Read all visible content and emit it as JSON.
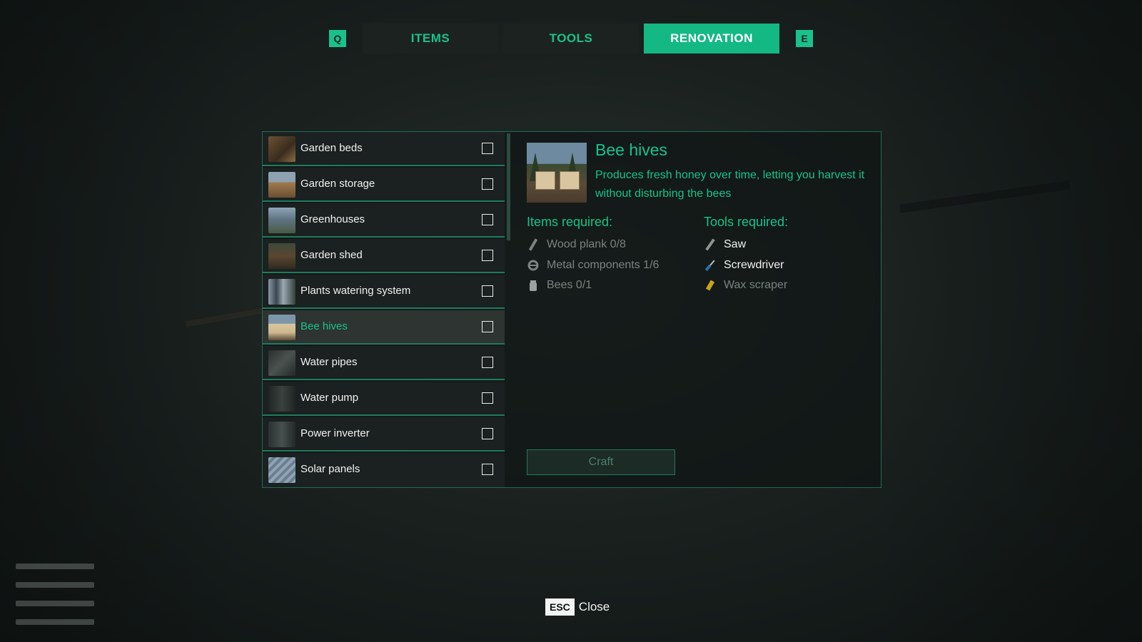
{
  "tabs": {
    "prev_key": "Q",
    "next_key": "E",
    "items": [
      {
        "label": "ITEMS",
        "active": false
      },
      {
        "label": "TOOLS",
        "active": false
      },
      {
        "label": "RENOVATION",
        "active": true
      }
    ]
  },
  "list": [
    {
      "label": "Garden beds",
      "thumb": "garden-beds",
      "selected": false,
      "checked": false
    },
    {
      "label": "Garden storage",
      "thumb": "garden-storage",
      "selected": false,
      "checked": false
    },
    {
      "label": "Greenhouses",
      "thumb": "greenhouses",
      "selected": false,
      "checked": false
    },
    {
      "label": "Garden shed",
      "thumb": "garden-shed",
      "selected": false,
      "checked": false
    },
    {
      "label": "Plants watering system",
      "thumb": "plants-watering-system",
      "selected": false,
      "checked": false
    },
    {
      "label": "Bee hives",
      "thumb": "bee-hives",
      "selected": true,
      "checked": false
    },
    {
      "label": "Water pipes",
      "thumb": "water-pipes",
      "selected": false,
      "checked": false
    },
    {
      "label": "Water pump",
      "thumb": "water-pump",
      "selected": false,
      "checked": false
    },
    {
      "label": "Power inverter",
      "thumb": "power-inverter",
      "selected": false,
      "checked": false
    },
    {
      "label": "Solar panels",
      "thumb": "solar-panels",
      "selected": false,
      "checked": false
    }
  ],
  "detail": {
    "title": "Bee hives",
    "description": "Produces fresh honey over time, letting you harvest it without disturbing the bees",
    "items_heading": "Items required:",
    "tools_heading": "Tools required:",
    "items_required": [
      {
        "label": "Wood plank 0/8",
        "icon": "wood-plank-icon",
        "available": false
      },
      {
        "label": "Metal components 1/6",
        "icon": "metal-components-icon",
        "available": false
      },
      {
        "label": "Bees 0/1",
        "icon": "bees-jar-icon",
        "available": false
      }
    ],
    "tools_required": [
      {
        "label": "Saw",
        "icon": "saw-icon",
        "available": true
      },
      {
        "label": "Screwdriver",
        "icon": "screwdriver-icon",
        "available": true
      },
      {
        "label": "Wax scraper",
        "icon": "wax-scraper-icon",
        "available": false
      }
    ],
    "craft_label": "Craft"
  },
  "footer": {
    "key": "ESC",
    "label": "Close"
  },
  "colors": {
    "accent": "#19c28a",
    "active_tab": "#14b883",
    "dim_text": "#7a8380",
    "border": "#1f7a5b"
  }
}
